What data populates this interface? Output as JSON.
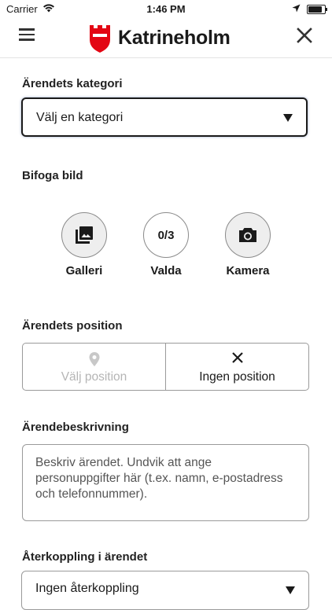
{
  "status_bar": {
    "carrier": "Carrier",
    "time": "1:46 PM"
  },
  "header": {
    "logo_text": "Katrineholm",
    "brand_color": "#e30613"
  },
  "category": {
    "label": "Ärendets kategori",
    "selected": "Välj en kategori"
  },
  "attach_image": {
    "label": "Bifoga bild",
    "options": [
      {
        "label": "Galleri",
        "icon": "gallery-icon"
      },
      {
        "label": "Valda",
        "count": "0/3"
      },
      {
        "label": "Kamera",
        "icon": "camera-icon"
      }
    ]
  },
  "position": {
    "label": "Ärendets position",
    "choose_label": "Välj position",
    "none_label": "Ingen position"
  },
  "description": {
    "label": "Ärendebeskrivning",
    "placeholder": "Beskriv ärendet. Undvik att ange personuppgifter här (t.ex. namn, e-postadress och telefonnummer)."
  },
  "feedback": {
    "label": "Återkoppling i ärendet",
    "selected": "Ingen återkoppling"
  }
}
